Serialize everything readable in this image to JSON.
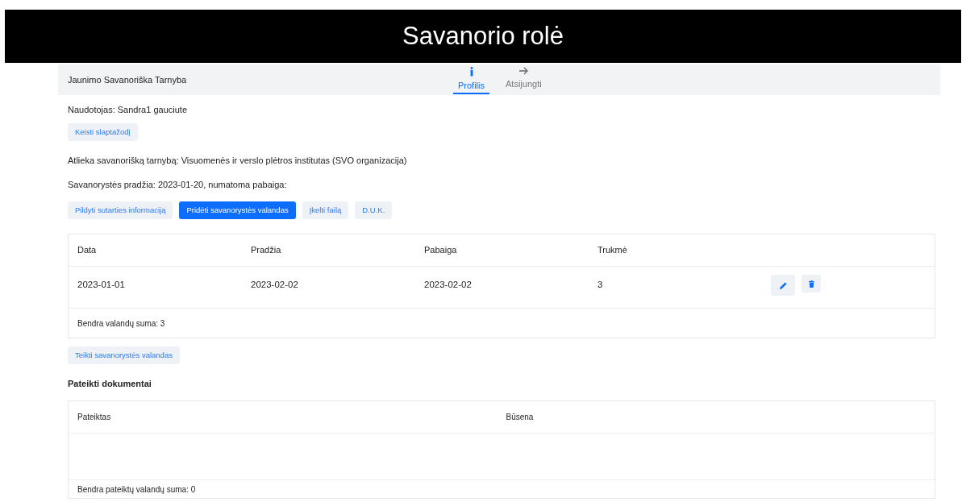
{
  "banner": {
    "title": "Savanorio rolė"
  },
  "navbar": {
    "brand": "Jaunimo Savanoriška Tarnyba",
    "items": [
      {
        "label": "Profilis",
        "kind": "info",
        "selected": true
      },
      {
        "label": "Atsijungti",
        "kind": "logout",
        "selected": false
      }
    ]
  },
  "user_line": "Naudotojas: Sandra1 gauciute",
  "password_button": {
    "label": "Keisti slaptažodį"
  },
  "service_line": "Atlieka savanorišką tarnybą: Visuomenės ir verslo plėtros institutas (SVO organizacija)",
  "dates_line": "Savanorystės pradžia: 2023-01-20, numatoma pabaiga:",
  "actions": [
    {
      "label": "Pildyti sutarties informaciją",
      "kind": "light"
    },
    {
      "label": "Pridėti savanorystės valandas",
      "kind": "primary"
    },
    {
      "label": "Įkelti failą",
      "kind": "light"
    },
    {
      "label": "D.U.K.",
      "kind": "light"
    }
  ],
  "hours_table": {
    "columns": [
      "Data",
      "Pradžia",
      "Pabaiga",
      "Trukmė"
    ],
    "rows": [
      {
        "cells": [
          "2023-01-01",
          "2023-02-02",
          "2023-02-02",
          "3"
        ]
      }
    ],
    "footer": "Bendra valandų suma: 3"
  },
  "submit_button": {
    "label": "Teikti savanorystės valandas"
  },
  "documents": {
    "heading": "Pateikti dokumentai",
    "columns": [
      "Pateiktas",
      "Būsena"
    ],
    "footer": "Bendra pateiktų valandų suma: 0"
  }
}
